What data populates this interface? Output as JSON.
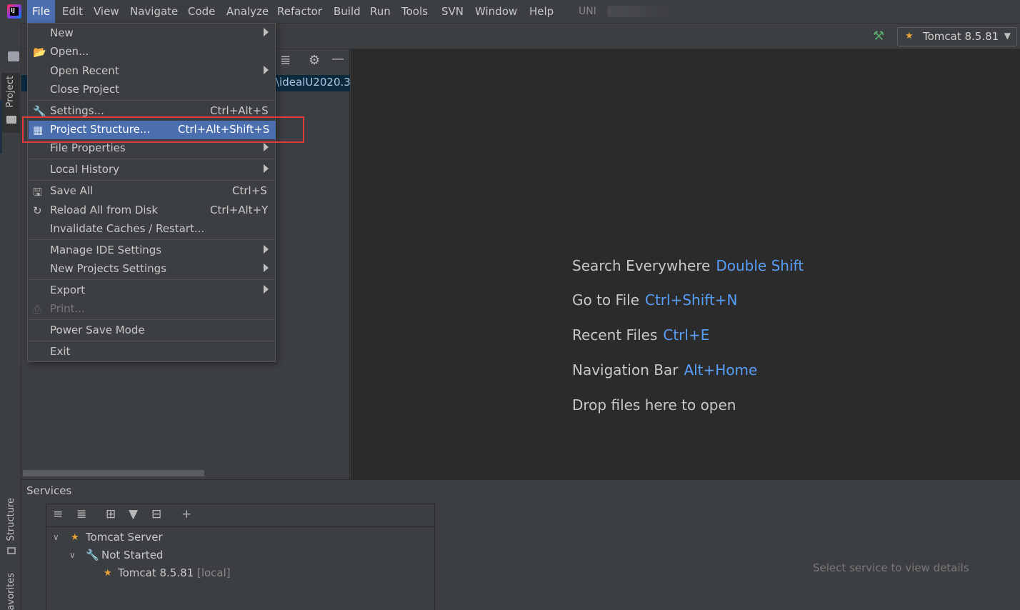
{
  "menubar": {
    "items": [
      "File",
      "Edit",
      "View",
      "Navigate",
      "Code",
      "Analyze",
      "Refactor",
      "Build",
      "Run",
      "Tools",
      "SVN",
      "Window",
      "Help"
    ],
    "project_title": "UNI"
  },
  "toolbar": {
    "run_config": "Tomcat 8.5.81"
  },
  "left_stripe": {
    "project_tab": "Project",
    "structure_tab": "Structure",
    "favorites_tab": "avorites"
  },
  "project_panel": {
    "path_fragment": "\\idealU2020.3"
  },
  "file_menu": {
    "items": [
      {
        "label": "New",
        "shortcut": ""
      },
      {
        "label": "Open...",
        "shortcut": ""
      },
      {
        "label": "Open Recent",
        "shortcut": ""
      },
      {
        "label": "Close Project",
        "shortcut": ""
      },
      {
        "label": "Settings...",
        "shortcut": "Ctrl+Alt+S"
      },
      {
        "label": "Project Structure...",
        "shortcut": "Ctrl+Alt+Shift+S"
      },
      {
        "label": "File Properties",
        "shortcut": ""
      },
      {
        "label": "Local History",
        "shortcut": ""
      },
      {
        "label": "Save All",
        "shortcut": "Ctrl+S"
      },
      {
        "label": "Reload All from Disk",
        "shortcut": "Ctrl+Alt+Y"
      },
      {
        "label": "Invalidate Caches / Restart...",
        "shortcut": ""
      },
      {
        "label": "Manage IDE Settings",
        "shortcut": ""
      },
      {
        "label": "New Projects Settings",
        "shortcut": ""
      },
      {
        "label": "Export",
        "shortcut": ""
      },
      {
        "label": "Print...",
        "shortcut": ""
      },
      {
        "label": "Power Save Mode",
        "shortcut": ""
      },
      {
        "label": "Exit",
        "shortcut": ""
      }
    ]
  },
  "editor": {
    "hints": [
      {
        "label": "Search Everywhere",
        "key": "Double Shift"
      },
      {
        "label": "Go to File",
        "key": "Ctrl+Shift+N"
      },
      {
        "label": "Recent Files",
        "key": "Ctrl+E"
      },
      {
        "label": "Navigation Bar",
        "key": "Alt+Home"
      },
      {
        "label": "Drop files here to open",
        "key": ""
      }
    ]
  },
  "services": {
    "title": "Services",
    "tree": {
      "server": "Tomcat Server",
      "group": "Not Started",
      "instance": "Tomcat 8.5.81",
      "instance_tag": "[local]"
    },
    "detail_placeholder": "Select service to view details"
  },
  "colors": {
    "accent": "#4b6eaf",
    "link": "#589df6",
    "highlight_box": "#e03a3a"
  }
}
